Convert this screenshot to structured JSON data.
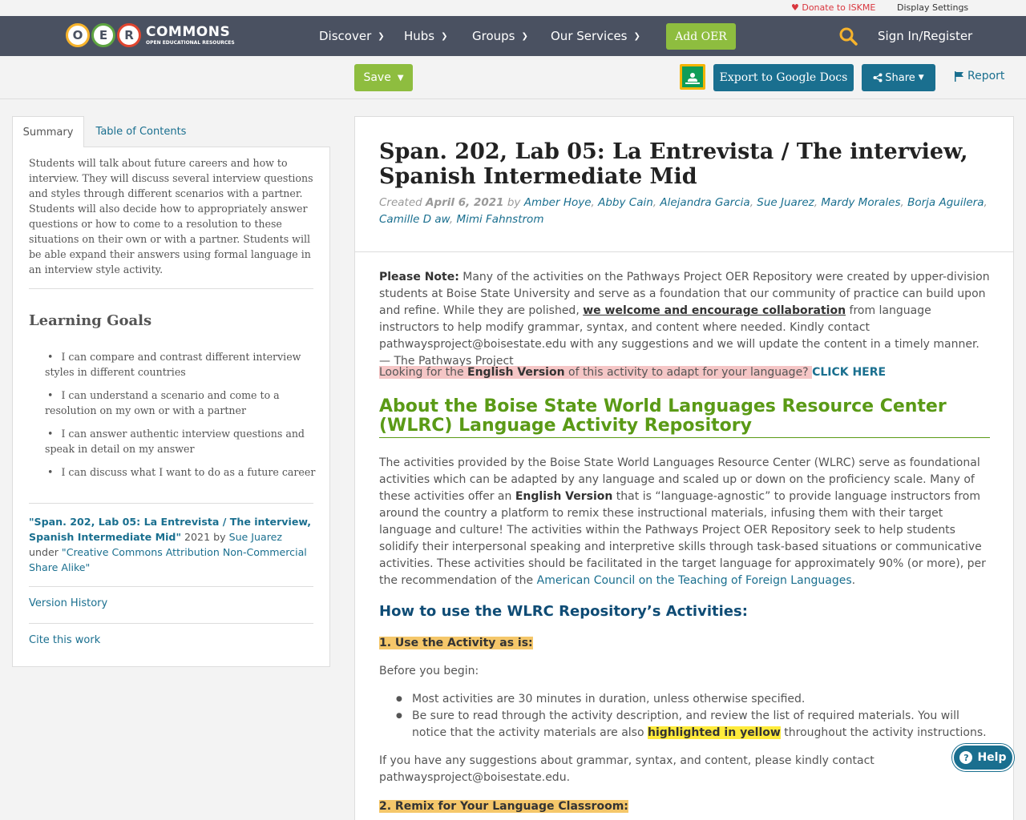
{
  "utility": {
    "donate": "♥ Donate to ISKME",
    "display_settings": "Display Settings"
  },
  "nav": {
    "logo_big": "COMMONS",
    "logo_small": "OPEN EDUCATIONAL RESOURCES",
    "logo_letters": [
      "O",
      "E",
      "R"
    ],
    "items": [
      "Discover",
      "Hubs",
      "Groups",
      "Our Services"
    ],
    "add_oer": "Add OER",
    "sign_in": "Sign In/Register"
  },
  "toolbar": {
    "save": "Save",
    "export": "Export to Google Docs",
    "share": "Share",
    "report": "Report"
  },
  "sidebar": {
    "tab_summary": "Summary",
    "tab_toc": "Table of Contents",
    "summary": "Students will talk about future careers and how to interview. They will discuss several interview questions and styles through different scenarios with a partner. Students will also decide how to appropriately answer questions or how to come to a resolution to these situations on their own or with a partner. Students will be able expand their answers using formal language in an interview style activity.",
    "learning_goals_title": "Learning Goals",
    "goals": [
      "I can compare and contrast different interview styles in different countries",
      "I can understand a scenario and come to a resolution on my own or with a partner",
      "I can answer authentic interview questions and speak in detail on my answer",
      "I can discuss what I want to do as a future career"
    ],
    "attrib_title": "\"Span. 202, Lab 05: La Entrevista / The interview, Spanish Intermediate Mid\"",
    "attrib_year": "2021",
    "attrib_by": "by",
    "attrib_author": "Sue Juarez",
    "attrib_under": "under",
    "attrib_license": "\"Creative Commons Attribution Non-Commercial Share Alike\"",
    "version_history": "Version History",
    "cite": "Cite this work"
  },
  "main": {
    "title": "Span. 202, Lab 05: La Entrevista / The interview, Spanish Intermediate Mid",
    "created_label": "Created",
    "created_date": "April 6, 2021",
    "by": "by",
    "authors": [
      "Amber Hoye",
      "Abby Cain",
      "Alejandra Garcia",
      "Sue Juarez",
      "Mardy Morales",
      "Borja Aguilera",
      "Camille D aw",
      "Mimi Fahnstrom"
    ],
    "note_label": "Please Note:",
    "note_1": " Many of the activities on the Pathways Project OER Repository were created by upper-division students at Boise State University and serve as a foundation that our community of practice can build upon and refine. While they are polished, ",
    "note_link": "we welcome and encourage collaboration",
    "note_2": " from language instructors to help modify grammar, syntax, and content where needed. Kindly contact pathwaysproject@boisestate.edu with any suggestions and we will update the content in a timely manner.  — The Pathways Project",
    "looking_1": "Looking for the ",
    "looking_bold": "English Version",
    "looking_2": " of this activity to adapt for your language? ",
    "click_here": "CLICK HERE",
    "about_heading": "About the Boise State World Languages Resource Center (WLRC) Language Activity Repository",
    "about_1": "The activities provided by the Boise State World Languages Resource Center (WLRC) serve as foundational activities which can be adapted by any language and scaled up or down on the proficiency scale. Many of these activities offer an ",
    "about_bold": "English Version",
    "about_2": " that is “language-agnostic” to provide language instructors from around the country a platform to remix these instructional materials, infusing them with their target language and culture! The activities within the Pathways Project OER Repository seek to help students solidify their interpersonal speaking and interpretive skills through task-based situations or communicative activities. These activities should be facilitated in the target language for approximately 90% (or more), per the recommendation of the ",
    "about_link": "American Council on the Teaching of Foreign Languages",
    "about_end": ".",
    "howto_heading": "How to use the WLRC Repository’s Activities:",
    "step1": "1. Use the Activity as is:",
    "before": "Before you begin:",
    "bullet1": "Most activities are 30 minutes in duration, unless otherwise specified.",
    "bullet2_1": "Be sure to read through the activity description, and review the list of required materials. You will notice that the activity materials are also ",
    "bullet2_hl": "highlighted in yellow",
    "bullet2_2": " throughout the activity instructions.",
    "suggest": "If you have any suggestions about grammar, syntax, and content, please kindly contact pathwaysproject@boisestate.edu.",
    "step2": "2. Remix for Your Language Classroom:"
  },
  "help": "Help",
  "colors": {
    "nav_bg": "#4a5161",
    "green": "#8ebd3f",
    "teal": "#1a6f8f",
    "heading_green": "#5a9a16",
    "heading_blue": "#0f4c75"
  }
}
